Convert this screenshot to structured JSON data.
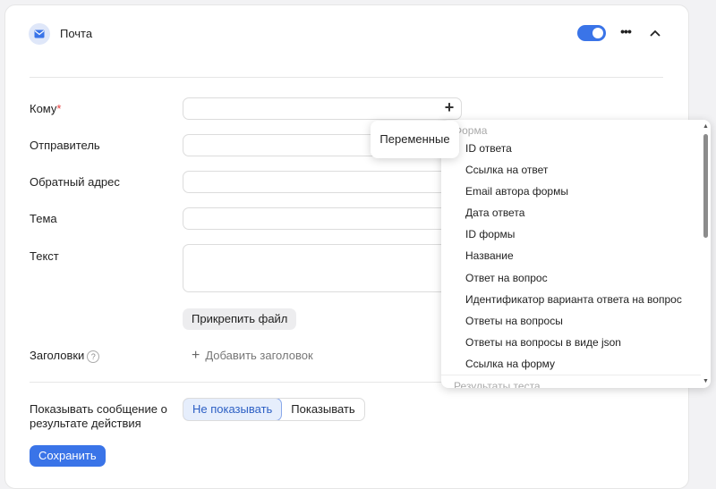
{
  "header": {
    "title": "Почта",
    "more_label": "•••"
  },
  "form": {
    "to_label": "Кому",
    "required_mark": "*",
    "sender_label": "Отправитель",
    "reply_to_label": "Обратный адрес",
    "subject_label": "Тема",
    "text_label": "Текст",
    "attach_button": "Прикрепить файл",
    "headers_label": "Заголовки",
    "help_mark": "?",
    "add_header": "Добавить заголовок",
    "show_result_label_line1": "Показывать сообщение о",
    "show_result_label_line2": "результате действия",
    "segment": [
      "Не показывать",
      "Показывать"
    ],
    "save_button": "Сохранить"
  },
  "tooltip": {
    "text": "Переменные"
  },
  "dropdown": {
    "group_form": "Форма",
    "items": [
      "ID ответа",
      "Ссылка на ответ",
      "Email автора формы",
      "Дата ответа",
      "ID формы",
      "Название",
      "Ответ на вопрос",
      "Идентификатор варианта ответа на вопрос",
      "Ответы на вопросы",
      "Ответы на вопросы в виде json",
      "Ссылка на форму"
    ],
    "group_results": "Результаты теста"
  },
  "colors": {
    "accent": "#3a74e8",
    "required": "#e53b3b"
  }
}
